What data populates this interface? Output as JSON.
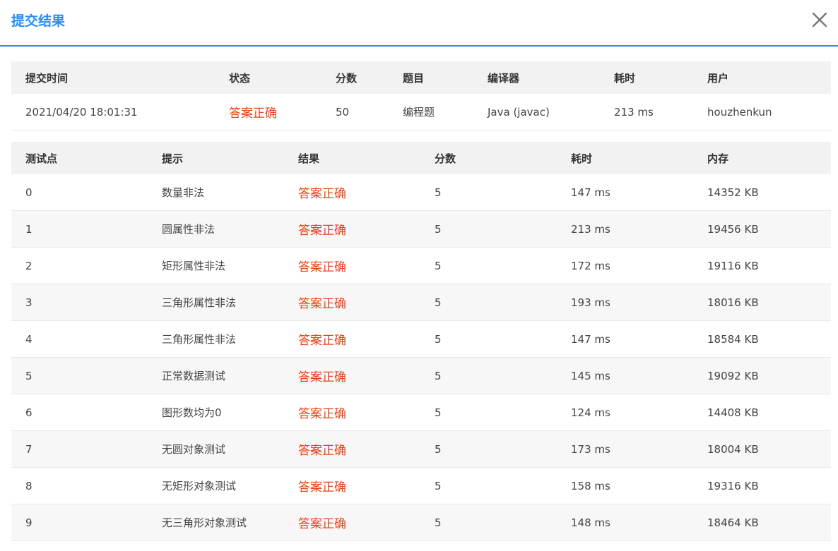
{
  "dialog": {
    "title": "提交结果"
  },
  "summary": {
    "headers": [
      "提交时间",
      "状态",
      "分数",
      "题目",
      "编译器",
      "耗时",
      "用户"
    ],
    "row": {
      "time": "2021/04/20 18:01:31",
      "status": "答案正确",
      "score": "50",
      "problem": "编程题",
      "compiler": "Java (javac)",
      "elapsed": "213 ms",
      "user": "houzhenkun"
    }
  },
  "cases": {
    "headers": [
      "测试点",
      "提示",
      "结果",
      "分数",
      "耗时",
      "内存"
    ],
    "rows": [
      {
        "id": "0",
        "hint": "数量非法",
        "result": "答案正确",
        "score": "5",
        "time": "147 ms",
        "memory": "14352 KB"
      },
      {
        "id": "1",
        "hint": "圆属性非法",
        "result": "答案正确",
        "score": "5",
        "time": "213 ms",
        "memory": "19456 KB"
      },
      {
        "id": "2",
        "hint": "矩形属性非法",
        "result": "答案正确",
        "score": "5",
        "time": "172 ms",
        "memory": "19116 KB"
      },
      {
        "id": "3",
        "hint": "三角形属性非法",
        "result": "答案正确",
        "score": "5",
        "time": "193 ms",
        "memory": "18016 KB"
      },
      {
        "id": "4",
        "hint": "三角形属性非法",
        "result": "答案正确",
        "score": "5",
        "time": "147 ms",
        "memory": "18584 KB"
      },
      {
        "id": "5",
        "hint": "正常数据测试",
        "result": "答案正确",
        "score": "5",
        "time": "145 ms",
        "memory": "19092 KB"
      },
      {
        "id": "6",
        "hint": "图形数均为0",
        "result": "答案正确",
        "score": "5",
        "time": "124 ms",
        "memory": "14408 KB"
      },
      {
        "id": "7",
        "hint": "无圆对象测试",
        "result": "答案正确",
        "score": "5",
        "time": "173 ms",
        "memory": "18004 KB"
      },
      {
        "id": "8",
        "hint": "无矩形对象测试",
        "result": "答案正确",
        "score": "5",
        "time": "158 ms",
        "memory": "19316 KB"
      },
      {
        "id": "9",
        "hint": "无三角形对象测试",
        "result": "答案正确",
        "score": "5",
        "time": "148 ms",
        "memory": "18464 KB"
      }
    ]
  },
  "colors": {
    "accent": "#2d8cf0",
    "status_ok": "#ed3f14",
    "header_bg": "#f2f2f2",
    "row_alt_bg": "#f7f7f7"
  },
  "icons": {
    "close": "close-icon"
  }
}
